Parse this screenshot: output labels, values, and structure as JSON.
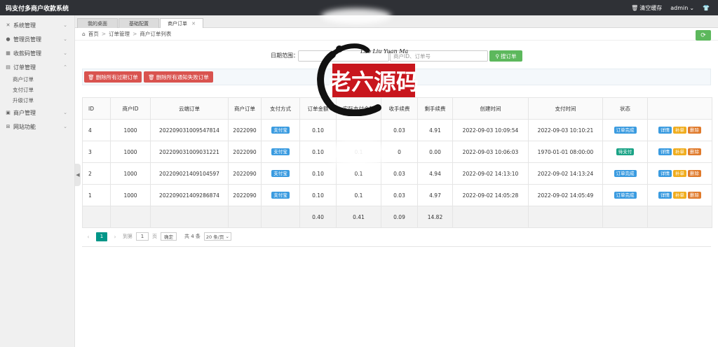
{
  "header": {
    "brand": "码支付多商户收款系统",
    "clear_cache": "清空缓存",
    "user": "admin"
  },
  "sidebar": {
    "items": [
      {
        "label": "系统管理",
        "icon": "wrench-icon"
      },
      {
        "label": "管理员管理",
        "icon": "user-icon"
      },
      {
        "label": "收款码管理",
        "icon": "qrcode-icon"
      },
      {
        "label": "订单管理",
        "icon": "order-icon",
        "expanded": true
      },
      {
        "label": "商户管理",
        "icon": "merchant-icon"
      },
      {
        "label": "网站功能",
        "icon": "globe-icon"
      }
    ],
    "subitems": [
      "商户订单",
      "支付订单",
      "升级订单"
    ]
  },
  "tabs": [
    {
      "label": "我的桌面"
    },
    {
      "label": "基础配置"
    },
    {
      "label": "商户订单",
      "active": true
    }
  ],
  "breadcrumb": {
    "home": "首页",
    "section": "订单管理",
    "page": "商户订单列表"
  },
  "search": {
    "label": "日期范围：",
    "keyword_placeholder": "商户ID、订单号",
    "button": "搜订单"
  },
  "actions": {
    "delete_expired": "删除所有过期订单",
    "delete_failed": "删除所有通知失败订单"
  },
  "table": {
    "headers": [
      "ID",
      "商户ID",
      "云端订单",
      "商户订单",
      "支付方式",
      "订单金额",
      "实际支付金额",
      "收手续费",
      "剩手续费",
      "创建时间",
      "支付时间",
      "状态",
      ""
    ],
    "rows": [
      {
        "id": "4",
        "mid": "1000",
        "cloud": "202209031009547814",
        "morder": "2022090",
        "pay": "支付宝",
        "amount": "0.10",
        "actual": "",
        "fee": "0.03",
        "remain": "4.91",
        "created": "2022-09-03 10:09:54",
        "paid": "2022-09-03 10:10:21",
        "status": "订单完成",
        "status_color": "#3a9be0"
      },
      {
        "id": "3",
        "mid": "1000",
        "cloud": "202209031009031221",
        "morder": "2022090",
        "pay": "支付宝",
        "amount": "0.10",
        "actual": "0.1",
        "fee": "0",
        "remain": "0.00",
        "created": "2022-09-03 10:06:03",
        "paid": "1970-01-01 08:00:00",
        "status": "待支付",
        "status_color": "#1aa386"
      },
      {
        "id": "2",
        "mid": "1000",
        "cloud": "202209021409104597",
        "morder": "2022090",
        "pay": "支付宝",
        "amount": "0.10",
        "actual": "0.1",
        "fee": "0.03",
        "remain": "4.94",
        "created": "2022-09-02 14:13:10",
        "paid": "2022-09-02 14:13:24",
        "status": "订单完成",
        "status_color": "#3a9be0"
      },
      {
        "id": "1",
        "mid": "1000",
        "cloud": "202209021409286874",
        "morder": "2022090",
        "pay": "支付宝",
        "amount": "0.10",
        "actual": "0.1",
        "fee": "0.03",
        "remain": "4.97",
        "created": "2022-09-02 14:05:28",
        "paid": "2022-09-02 14:05:49",
        "status": "订单完成",
        "status_color": "#3a9be0"
      }
    ],
    "ops": {
      "detail": "详情",
      "reissue": "补单",
      "delete": "删除"
    },
    "totals": {
      "amount": "0.40",
      "actual": "0.41",
      "fee": "0.09",
      "remain": "14.82"
    }
  },
  "pager": {
    "current": "1",
    "goto_prefix": "到第",
    "goto_value": "1",
    "goto_suffix": "页",
    "confirm": "确定",
    "total": "共 4 条",
    "page_size": "20 条/页"
  },
  "watermark": {
    "text": "老六源码",
    "signature": "Lao Liu Yuan Ma"
  },
  "colors": {
    "topbar": "#2f3136",
    "green": "#5cb85c",
    "red": "#d9534f",
    "blue_badge": "#3a9be0",
    "teal_badge": "#1aa386",
    "pager_active": "#009688"
  }
}
